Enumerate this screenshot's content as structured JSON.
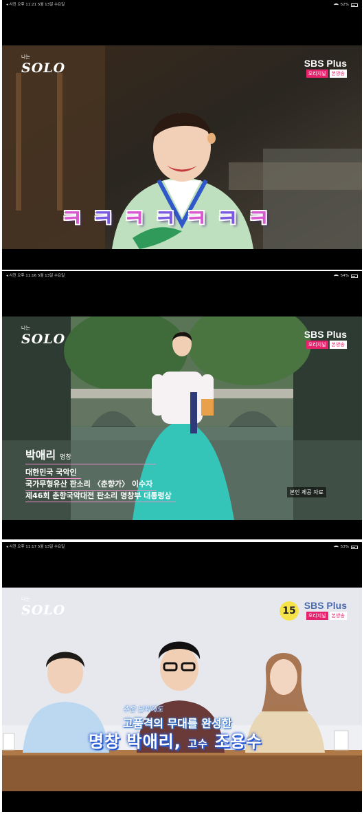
{
  "screens": [
    {
      "status": {
        "left": "◂ 사진   오후 11:21   5월 13일 수요일",
        "battery": "52%",
        "battery_level": 0.52
      },
      "logo": {
        "small": "나는",
        "main": "SOLO"
      },
      "broadcaster": {
        "brand": "SBS Plus",
        "tag1": "오리지널",
        "tag2": "본방송"
      },
      "subtitle_chars": [
        "ㅋ",
        "ㅋ",
        "ㅋ",
        "ㅋ",
        "ㅋ",
        "ㅋ",
        "ㅋ"
      ]
    },
    {
      "status": {
        "left": "◂ 사진   오후 11:16   5월 13일 수요일",
        "battery": "54%",
        "battery_level": 0.54
      },
      "logo": {
        "small": "나는",
        "main": "SOLO"
      },
      "broadcaster": {
        "brand": "SBS Plus",
        "tag1": "오리지널",
        "tag2": "본방송"
      },
      "person": {
        "name": "박애리",
        "title": "명창"
      },
      "bio": [
        "대한민국 국악인",
        "국가무형유산 판소리 〈춘향가〉 이수자",
        "제46회 춘향국악대전 판소리 명창부 대통령상"
      ],
      "credit": "본인 제공 자료"
    },
    {
      "status": {
        "left": "◂ 사진   오후 11:17   5월 13일 수요일",
        "battery": "53%",
        "battery_level": 0.53
      },
      "logo": {
        "small": "나는",
        "main": "SOLO"
      },
      "broadcaster": {
        "brand": "SBS Plus",
        "tag1": "오리지널",
        "tag2": "본방송"
      },
      "age_rating": "15",
      "caption_line1": "추운 날씨에도",
      "caption_line2": "고품격의 무대를 완성한",
      "caption_line3a": "명창 박애리,",
      "caption_line3b": "고수",
      "caption_line3c": "조용수"
    }
  ]
}
